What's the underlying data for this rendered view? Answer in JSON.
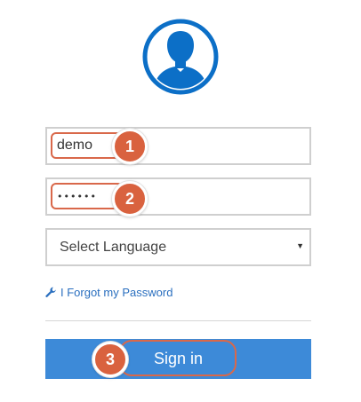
{
  "avatar": {
    "icon": "user-avatar-icon",
    "color": "#0c6fc7"
  },
  "username": {
    "value": "demo",
    "badge": "1"
  },
  "password": {
    "value": "••••••",
    "badge": "2"
  },
  "language": {
    "selected": "Select Language",
    "icon": "caret-down-icon"
  },
  "forgot": {
    "label": "I Forgot my Password",
    "icon": "wrench-icon",
    "color": "#2a6fbf"
  },
  "signin": {
    "label": "Sign in",
    "badge": "3",
    "color": "#3d8ad8"
  },
  "annotation": {
    "color": "#d9623f"
  }
}
